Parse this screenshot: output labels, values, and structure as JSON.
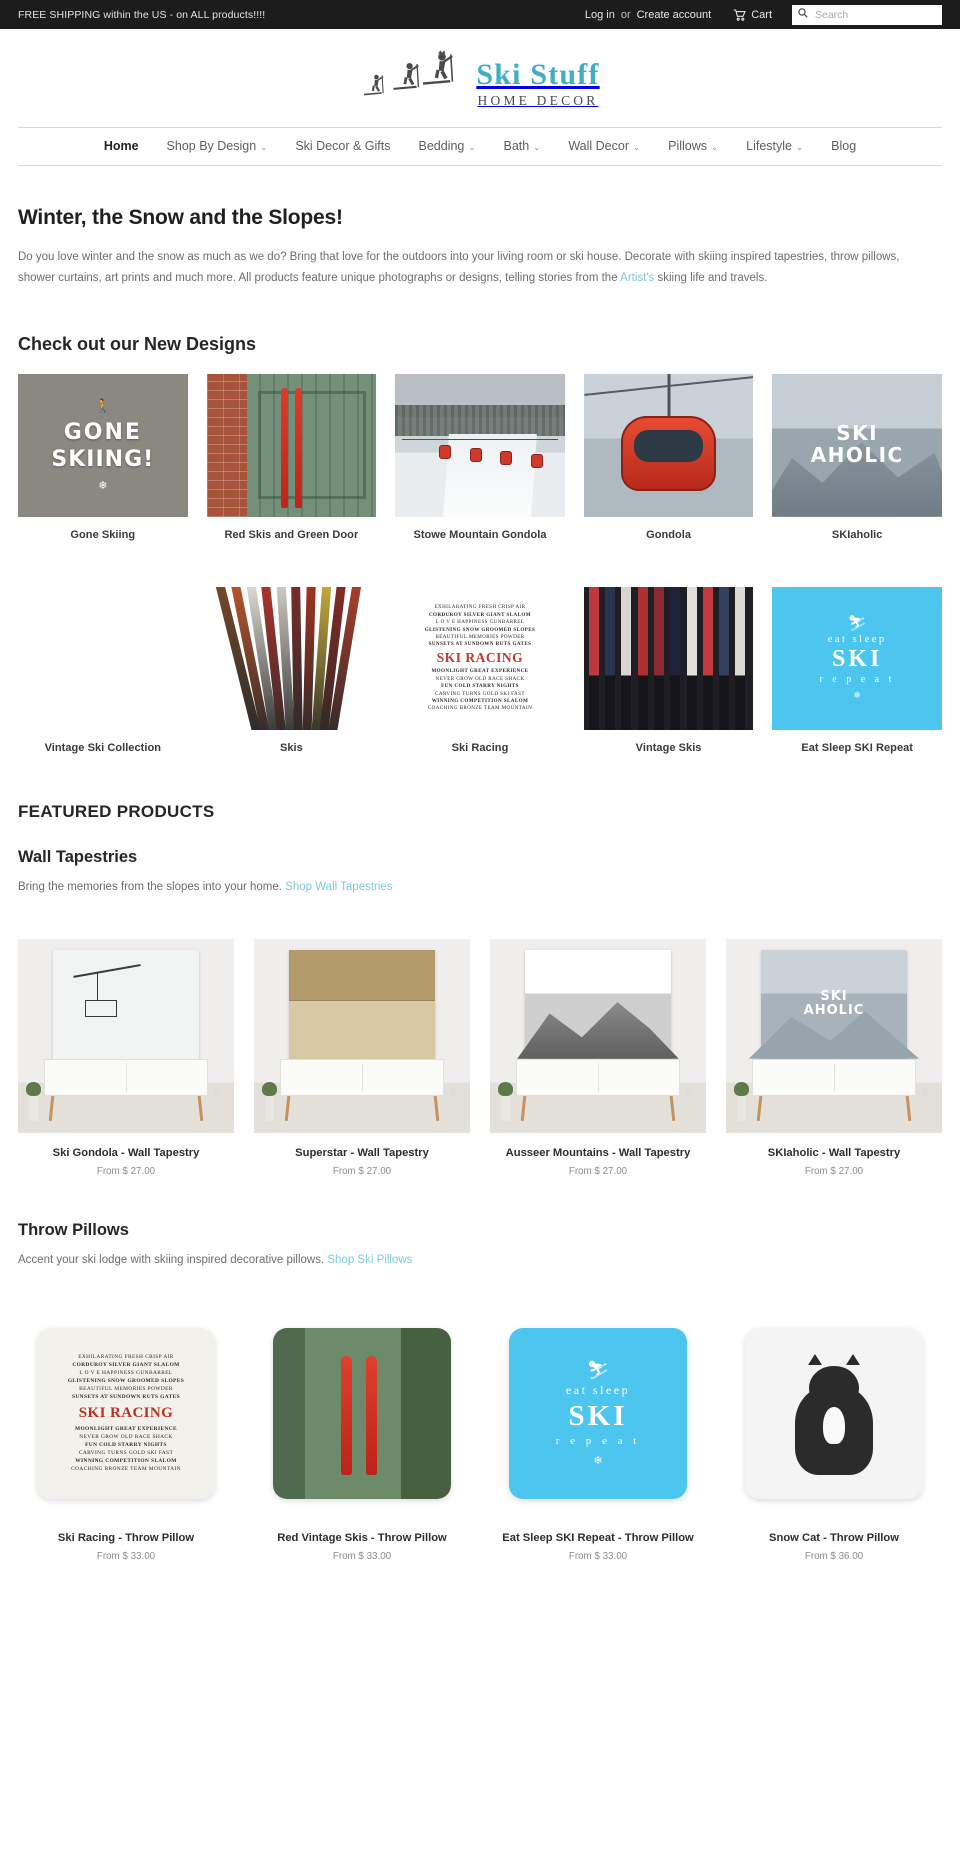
{
  "topbar": {
    "promo": "FREE SHIPPING within the US - on ALL products!!!!",
    "login": "Log in",
    "or": "or",
    "create_account": "Create account",
    "cart": "Cart",
    "search_placeholder": "Search",
    "search_value": ""
  },
  "logo": {
    "title": "Ski Stuff",
    "subtitle": "HOME DECOR",
    "accent_color": "#3fafc8"
  },
  "nav": {
    "items": [
      {
        "label": "Home",
        "has_dropdown": false,
        "active": true
      },
      {
        "label": "Shop By Design",
        "has_dropdown": true,
        "active": false
      },
      {
        "label": "Ski Decor & Gifts",
        "has_dropdown": false,
        "active": false
      },
      {
        "label": "Bedding",
        "has_dropdown": true,
        "active": false
      },
      {
        "label": "Bath",
        "has_dropdown": true,
        "active": false
      },
      {
        "label": "Wall Decor",
        "has_dropdown": true,
        "active": false
      },
      {
        "label": "Pillows",
        "has_dropdown": true,
        "active": false
      },
      {
        "label": "Lifestyle",
        "has_dropdown": true,
        "active": false
      },
      {
        "label": "Blog",
        "has_dropdown": false,
        "active": false
      }
    ]
  },
  "intro": {
    "heading": "Winter, the Snow and the Slopes!",
    "text_before": "Do you love winter and the snow as much as we do? Bring that love for the outdoors into your living room or ski house. Decorate with skiing inspired tapestries, throw pillows, shower curtains, art prints and much more. All products feature unique photographs or designs, telling stories from the ",
    "link": "Artist's",
    "text_after": " skiing life and travels."
  },
  "designs": {
    "heading": "Check out our New Designs",
    "row1": [
      {
        "caption": "Gone Skiing"
      },
      {
        "caption": "Red Skis and Green Door"
      },
      {
        "caption": "Stowe Mountain Gondola"
      },
      {
        "caption": "Gondola"
      },
      {
        "caption": "SKIaholic"
      }
    ],
    "row2": [
      {
        "caption": "Vintage Ski Collection"
      },
      {
        "caption": "Skis"
      },
      {
        "caption": "Ski Racing"
      },
      {
        "caption": "Vintage Skis"
      },
      {
        "caption": "Eat Sleep SKI Repeat"
      }
    ]
  },
  "featured": {
    "heading": "FEATURED PRODUCTS"
  },
  "tapestries": {
    "heading": "Wall Tapestries",
    "desc": "Bring the memories from the slopes into your home. ",
    "link": "Shop Wall Tapestries",
    "products": [
      {
        "name": "Ski Gondola - Wall Tapestry",
        "price": "From $ 27.00"
      },
      {
        "name": "Superstar - Wall Tapestry",
        "price": "From $ 27.00"
      },
      {
        "name": "Ausseer Mountains - Wall Tapestry",
        "price": "From $ 27.00"
      },
      {
        "name": "SKIaholic - Wall Tapestry",
        "price": "From $ 27.00"
      }
    ]
  },
  "pillows": {
    "heading": "Throw Pillows",
    "desc": "Accent your ski lodge with skiing inspired decorative pillows. ",
    "link": "Shop Ski Pillows",
    "products": [
      {
        "name": "Ski Racing - Throw Pillow",
        "price": "From $ 33.00"
      },
      {
        "name": "Red Vintage Skis - Throw Pillow",
        "price": "From $ 33.00"
      },
      {
        "name": "Eat Sleep SKI Repeat - Throw Pillow",
        "price": "From $ 33.00"
      },
      {
        "name": "Snow Cat - Throw Pillow",
        "price": "From $ 36.00"
      }
    ]
  },
  "art_text": {
    "gone_skiing_l1": "GONE",
    "gone_skiing_l2": "SKIING!",
    "skiaholic_l1": "SKI",
    "skiaholic_l2": "AHOLIC",
    "eat": "eat  sleep",
    "ski": "SKI",
    "repeat": "r e p e a t",
    "tap_ski_l1": "SKI",
    "tap_ski_l2": "AHOLIC",
    "racing_lines": [
      "EXHILARATING   FRESH CRISP AIR",
      "CORDUROY  SILVER  GIANT SLALOM",
      "L O V E    HAPPINESS   GUNBARREL",
      "GLISTENING SNOW   GROOMED SLOPES",
      "BEAUTIFUL MEMORIES   POWDER",
      "SUNSETS AT SUNDOWN  RUTS  GATES"
    ],
    "racing_big": "SKI RACING",
    "racing_lines2": [
      "MOONLIGHT   GREAT EXPERIENCE",
      "NEVER GROW OLD   RACE SHACK",
      "FUN   COLD STARRY NIGHTS",
      "CARVING TURNS GOLD SKI FAST",
      "WINNING  COMPETITION   SLALOM",
      "COACHING BRONZE TEAM MOUNTAIN"
    ]
  }
}
